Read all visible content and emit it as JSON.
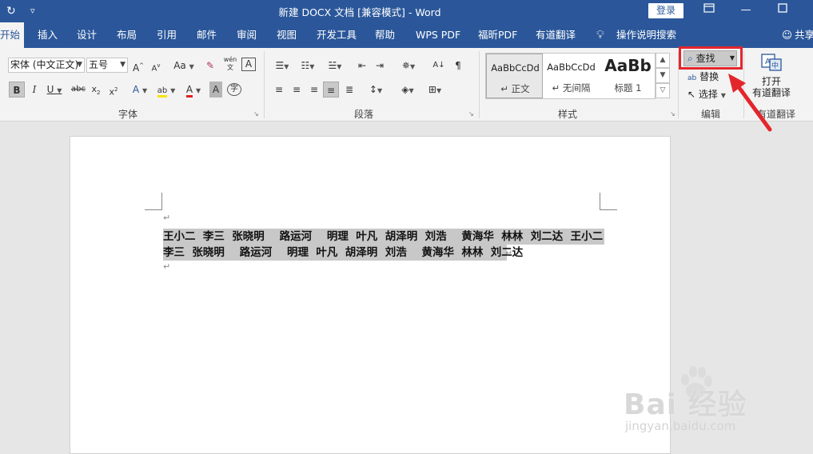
{
  "title_bar": {
    "title": "新建 DOCX 文档 [兼容模式]  -  Word",
    "login_label": "登录",
    "quick_access": [
      "refresh-icon",
      "customize-icon"
    ]
  },
  "tabs": [
    "开始",
    "插入",
    "设计",
    "布局",
    "引用",
    "邮件",
    "审阅",
    "视图",
    "开发工具",
    "帮助",
    "WPS PDF",
    "福昕PDF",
    "有道翻译",
    "操作说明搜索"
  ],
  "tab_share": "共享",
  "font_group": {
    "font_name": "宋体 (中文正文)",
    "font_size": "五号",
    "label": "字体",
    "buttons": [
      "A",
      "A",
      "Aa",
      "abc",
      "x₂",
      "x²",
      "B",
      "I",
      "U",
      "A"
    ],
    "phonetic_label": "wén"
  },
  "paragraph_group": {
    "label": "段落"
  },
  "styles_group": {
    "label": "样式",
    "items": [
      {
        "sample": "AaBbCcDd",
        "name": "↵ 正文"
      },
      {
        "sample": "AaBbCcDd",
        "name": "↵ 无间隔"
      },
      {
        "sample": "AaBb",
        "name": "标题 1"
      }
    ]
  },
  "editing_group": {
    "label": "编辑",
    "find": "查找",
    "replace": "替换",
    "select": "选择"
  },
  "translate_group": {
    "label": "有道翻译",
    "open_label": "打开",
    "button_label": "有道翻译"
  },
  "document": {
    "line1": "王小二  李三  张晓明    路运河    明理  叶凡  胡泽明  刘浩    黄海华  林林  刘二达  王小二",
    "line2": "李三  张晓明    路运河    明理  叶凡  胡泽明  刘浩    黄海华  林林  刘二达",
    "para_mark": "↵"
  },
  "watermark": {
    "brand": "Bai 经验",
    "url": "jingyan.baidu.com"
  },
  "colors": {
    "title_bar": "#2b579a",
    "ribbon": "#f3f3f3",
    "highlight_box": "#e3262c",
    "selection": "#c8c8c8"
  }
}
